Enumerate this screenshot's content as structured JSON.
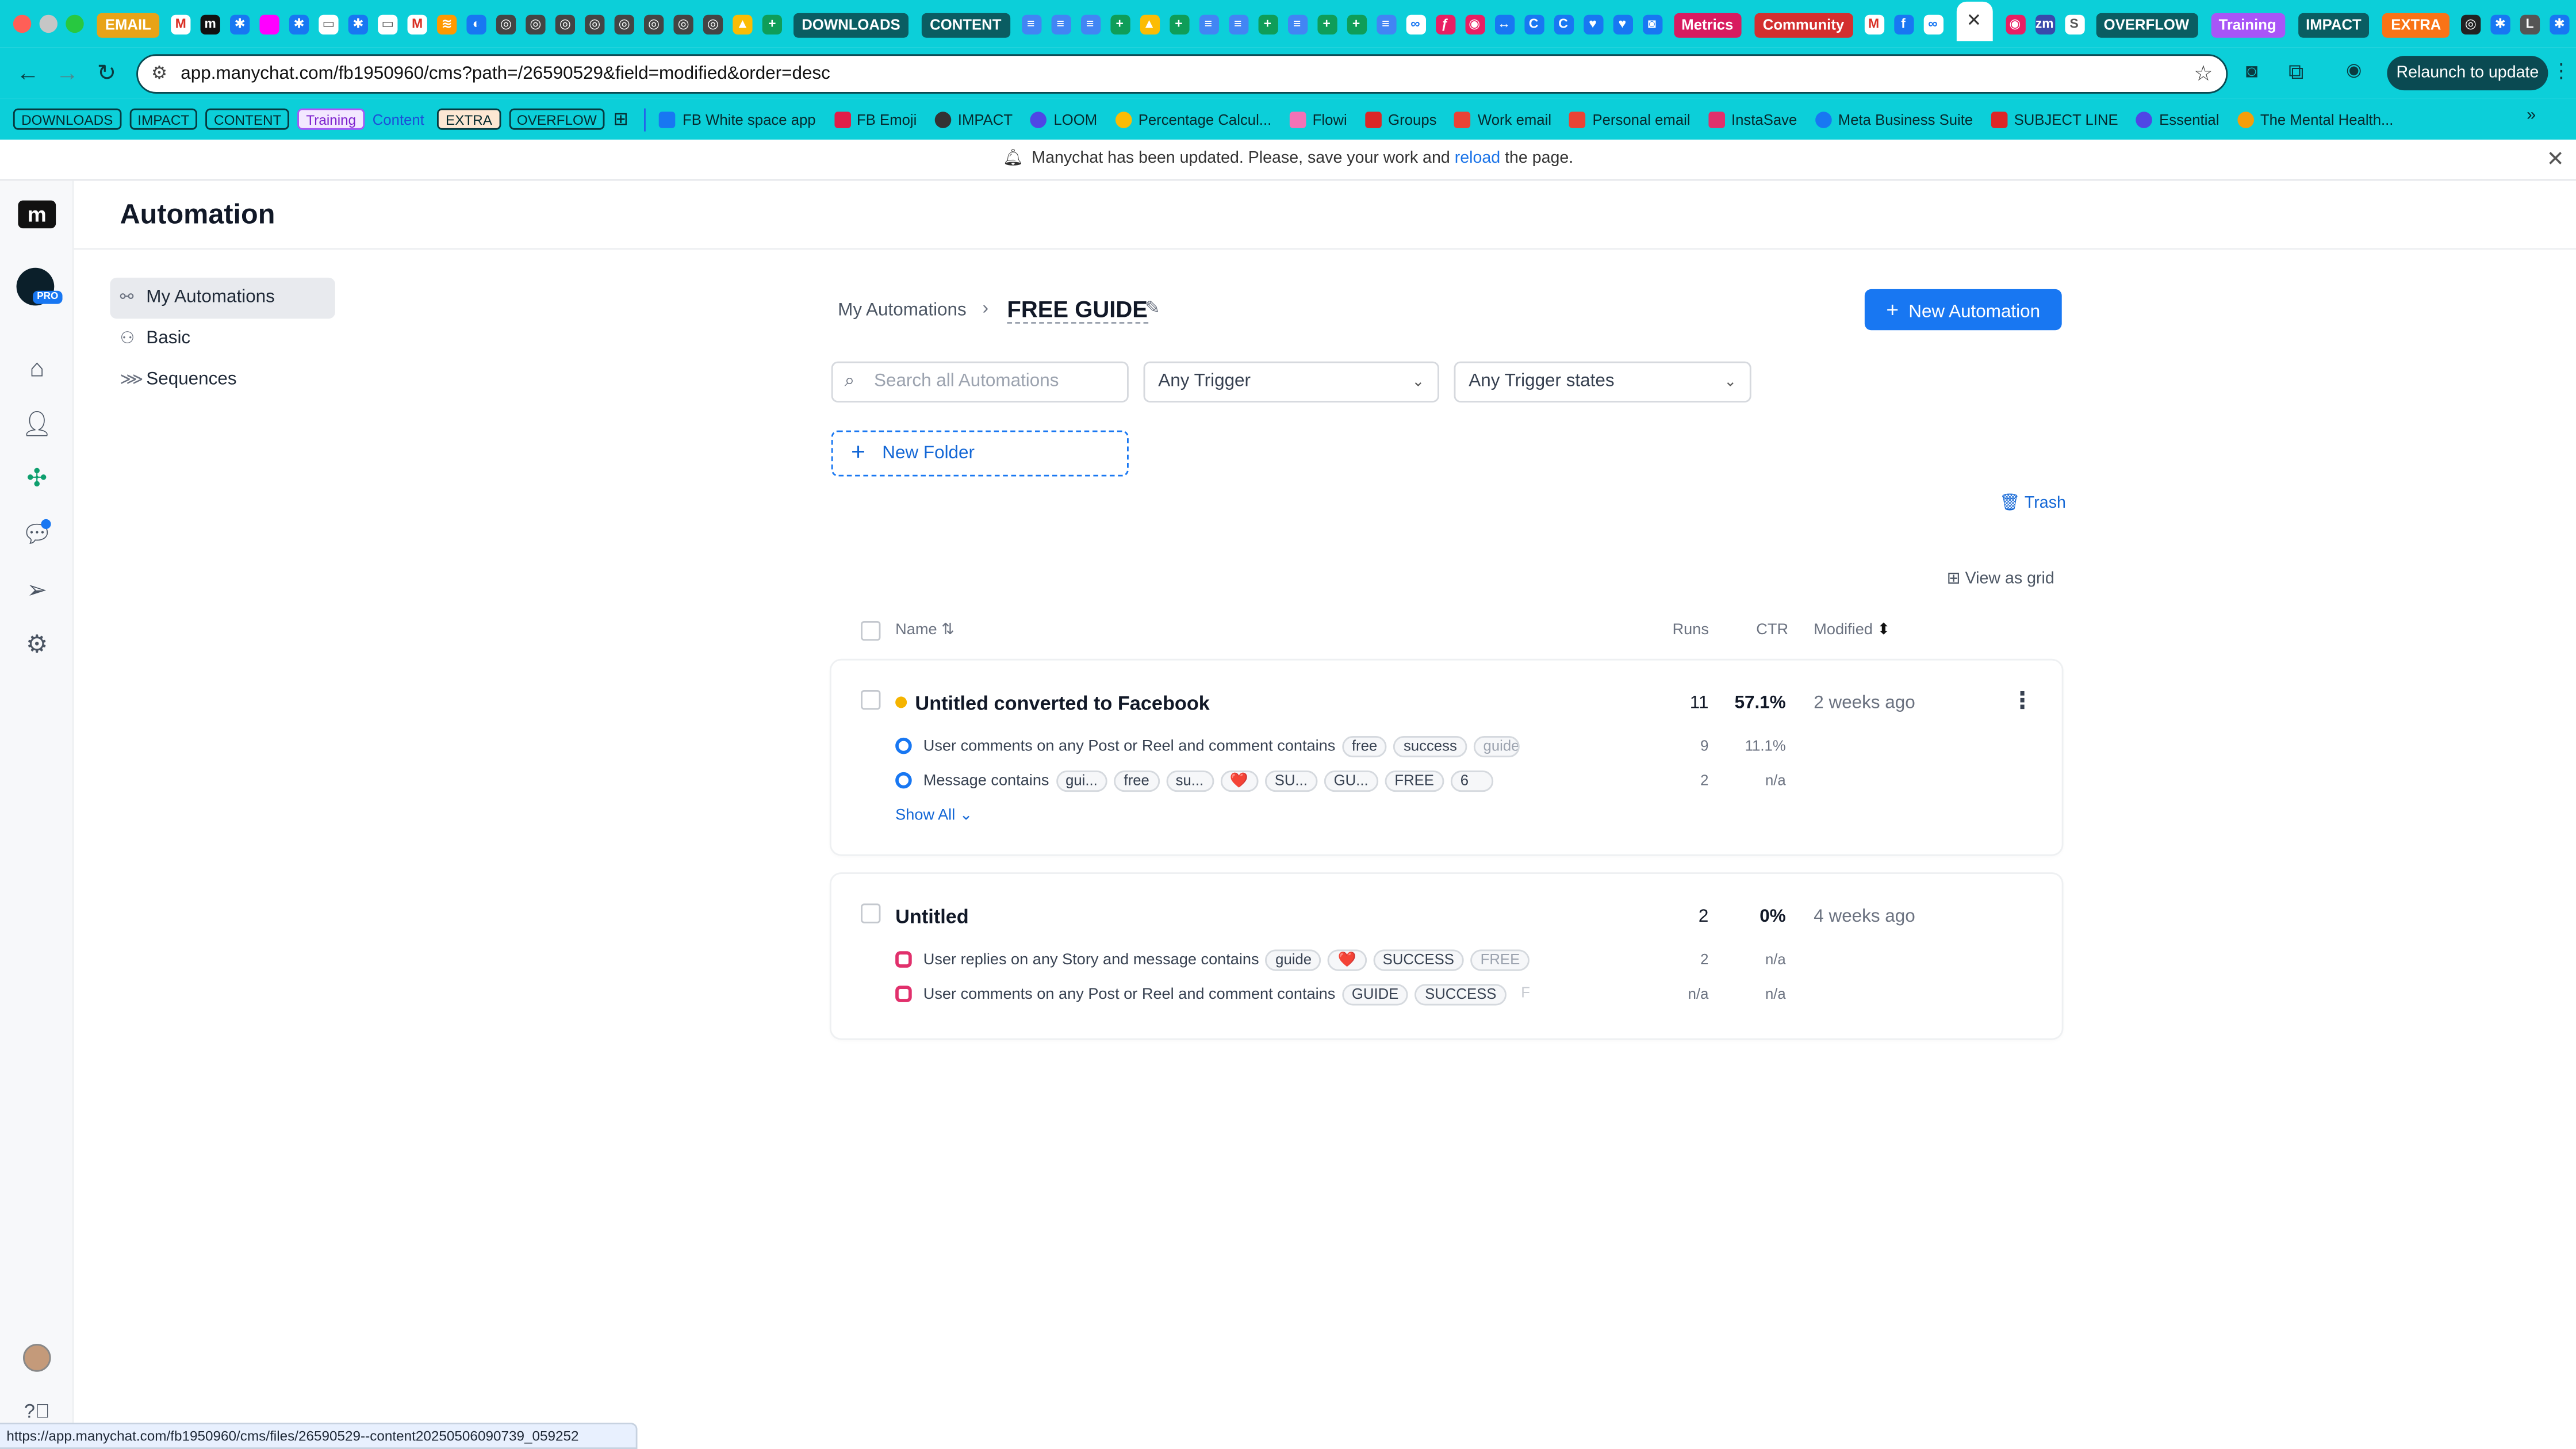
{
  "browser": {
    "tab_groups": [
      "EMAIL",
      "DOWNLOADS",
      "CONTENT",
      "Metrics",
      "Community",
      "OVERFLOW",
      "Training",
      "IMPACT",
      "EXTRA"
    ],
    "url": "app.manychat.com/fb1950960/cms?path=/26590529&field=modified&order=desc",
    "relaunch_label": "Relaunch to update",
    "status_url": "https://app.manychat.com/fb1950960/cms/files/26590529--content20250506090739_059252"
  },
  "bookmarks": {
    "tags": [
      "DOWNLOADS",
      "IMPACT",
      "CONTENT",
      "Training"
    ],
    "content_label": "Content",
    "tags2": [
      "EXTRA",
      "OVERFLOW"
    ],
    "items": [
      "FB White space app",
      "FB Emoji",
      "IMPACT",
      "LOOM",
      "Percentage Calcul...",
      "Flowi",
      "Groups",
      "Work email",
      "Personal email",
      "InstaSave",
      "Meta Business Suite",
      "SUBJECT LINE",
      "Essential",
      "The Mental Health..."
    ]
  },
  "notice": {
    "before": "Manychat has been updated. Please, save your work and ",
    "link": "reload",
    "after": " the page."
  },
  "header": {
    "title": "Automation"
  },
  "avatar": {
    "badge": "PRO"
  },
  "sidebar": {
    "items": [
      {
        "label": "My Automations"
      },
      {
        "label": "Basic"
      },
      {
        "label": "Sequences"
      }
    ]
  },
  "main": {
    "breadcrumb_root": "My Automations",
    "folder_title": "FREE GUIDE",
    "new_automation": "New Automation",
    "search_placeholder": "Search all Automations",
    "trigger_filter": "Any Trigger",
    "trigger_state_filter": "Any Trigger states",
    "new_folder": "New Folder",
    "trash": "Trash",
    "view_grid": "View as grid",
    "columns": {
      "name": "Name",
      "runs": "Runs",
      "ctr": "CTR",
      "modified": "Modified"
    },
    "rows": [
      {
        "title": "Untitled converted to Facebook",
        "runs": "11",
        "ctr": "57.1%",
        "modified": "2 weeks ago",
        "status_color": "#f5b400",
        "rules": [
          {
            "text": "User comments on any Post or Reel and comment contains",
            "chips": [
              "free",
              "success",
              "guide"
            ],
            "runs": "9",
            "ctr": "11.1%",
            "channel": "messenger"
          },
          {
            "text": "Message contains",
            "chips": [
              "gui...",
              "free",
              "su...",
              "❤️",
              "SU...",
              "GU...",
              "FREE",
              "6"
            ],
            "runs": "2",
            "ctr": "n/a",
            "channel": "messenger"
          }
        ],
        "show_all": "Show All"
      },
      {
        "title": "Untitled",
        "runs": "2",
        "ctr": "0%",
        "modified": "4 weeks ago",
        "rules": [
          {
            "text": "User replies on any Story and message contains",
            "chips": [
              "guide",
              "❤️",
              "SUCCESS",
              "FREE"
            ],
            "runs": "2",
            "ctr": "n/a",
            "channel": "instagram"
          },
          {
            "text": "User comments on any Post or Reel and comment contains",
            "chips": [
              "GUIDE",
              "SUCCESS",
              "F"
            ],
            "runs": "n/a",
            "ctr": "n/a",
            "channel": "instagram"
          }
        ]
      }
    ]
  },
  "colors": {
    "accent": "#1877f2",
    "browser": "#0ccfd9"
  }
}
